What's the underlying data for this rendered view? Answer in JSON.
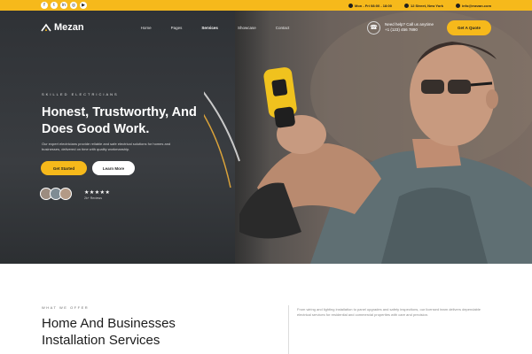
{
  "topbar": {
    "social_icons": [
      "facebook-icon",
      "twitter-icon",
      "linkedin-icon",
      "instagram-icon",
      "youtube-icon"
    ],
    "info": [
      {
        "icon": "clock-icon",
        "text": "Mon - Fri 08:00 - 18:00"
      },
      {
        "icon": "pin-icon",
        "text": "12 Street, New York"
      },
      {
        "icon": "mail-icon",
        "text": "info@mezan.com"
      }
    ]
  },
  "nav": {
    "logo": "Mezan",
    "links": [
      "Home",
      "Pages",
      "Services",
      "Showcase",
      "Contact"
    ],
    "active_link": "Services",
    "phone_label": "Need help? Call us anytime",
    "phone_number": "+1 (123) 456 7890",
    "cta": "Get A Quote"
  },
  "hero": {
    "eyebrow": "SKILLED ELECTRICIANS",
    "headline": "Honest, Trustworthy, And Does Good Work.",
    "lead": "Our expert electricians provide reliable and safe electrical solutions for homes and businesses, delivered on time with quality workmanship.",
    "primary_button": "Get Started",
    "secondary_button": "Learn More",
    "stars": "★★★★★",
    "rating_text": "2k+ Reviews"
  },
  "section": {
    "eyebrow": "WHAT WE OFFER",
    "heading_line1": "Home And Businesses",
    "heading_line2": "Installation Services",
    "body": "From wiring and lighting installation to panel upgrades and safety inspections, our licensed team delivers dependable electrical services for residential and commercial properties with care and precision."
  },
  "colors": {
    "accent": "#f6b91b",
    "dark": "#2f3236",
    "text": "#1c1c1c"
  }
}
